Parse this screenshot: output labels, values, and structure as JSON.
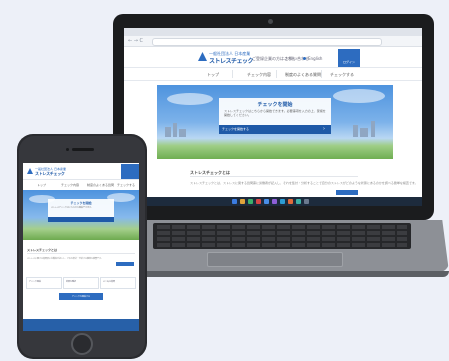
{
  "browser": {
    "nav_glyphs": "← → C"
  },
  "site": {
    "logo_line1": "一般社団法人 日本産業",
    "logo_line2": "ストレスチェック",
    "header_links": [
      "ご登録企業の方はこちら",
      "お問い合わせ",
      "English"
    ],
    "header_cta": "ログイン",
    "nav": [
      "トップ",
      "チェック内容",
      "制度のよくある質問",
      "チェックする"
    ],
    "hero": {
      "title": "チェックを開始",
      "text": "ストレスチェックはこちらから開始できます。必要事項を入力の上、受検を開始してください。",
      "button": "チェックを開始する",
      "arrow": "›"
    },
    "section": {
      "title": "ストレスチェックとは",
      "text": "ストレスチェックとは、ストレスに関する質問票に労働者が記入し、それを集計・分析することで自分のストレスがどのような状態にあるのかを調べる簡単な検査です。"
    }
  },
  "mobile": {
    "logo_line1": "一般社団法人 日本産業",
    "logo_line2": "ストレスチェック",
    "nav": [
      "トップ",
      "チェック内容",
      "制度のよくある質問",
      "チェックする"
    ],
    "hero_title": "チェックを開始",
    "hero_text": "ストレスチェックはこちらから開始できます。",
    "section_title": "ストレスチェックとは",
    "section_text": "ストレスに関する質問票に労働者が記入し、それを集計・分析する簡単な検査です。",
    "grid": [
      "チェック開始",
      "結果を確認",
      "よくある質問"
    ],
    "big_button": "チェックを開始する"
  },
  "colors": {
    "brand": "#2d6cc0",
    "brand_dark": "#1f5aa8",
    "footer": "#2760a8"
  }
}
